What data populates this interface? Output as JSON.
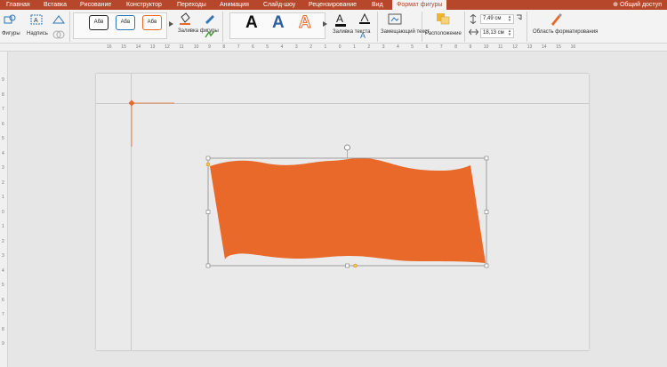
{
  "tabs": [
    "Главная",
    "Вставка",
    "Рисование",
    "Конструктор",
    "Переходы",
    "Анимация",
    "Слайд-шоу",
    "Рецензирование",
    "Вид",
    "Формат фигуры"
  ],
  "active_tab": "Формат фигуры",
  "share_label": "Общий доступ",
  "ribbon": {
    "shapes_label": "Фигуры",
    "textbox_label": "Надпись",
    "style_sample": "Абв",
    "shape_fill_label": "Заливка фигуры",
    "wordart_letter": "A",
    "text_fill_label": "Заливка текста",
    "alt_text_label": "Замещающий текст",
    "arrange_label": "Расположение",
    "height_value": "7,49 см",
    "width_value": "18,13 см",
    "format_pane_label": "Область форматирования"
  },
  "ruler_h": [
    "16",
    "15",
    "14",
    "13",
    "12",
    "11",
    "10",
    "9",
    "8",
    "7",
    "6",
    "5",
    "4",
    "3",
    "2",
    "1",
    "0",
    "1",
    "2",
    "3",
    "4",
    "5",
    "6",
    "7",
    "8",
    "9",
    "10",
    "11",
    "12",
    "13",
    "14",
    "15",
    "16"
  ],
  "ruler_v": [
    "9",
    "8",
    "7",
    "6",
    "5",
    "4",
    "3",
    "2",
    "1",
    "0",
    "1",
    "2",
    "3",
    "4",
    "5",
    "6",
    "7",
    "8",
    "9"
  ],
  "colors": {
    "accent": "#b7472a",
    "shape_fill": "#e8692a",
    "selection_handle": "#888888",
    "wordart_blue": "#2e5e9e",
    "wordart_orange": "#e8692a"
  },
  "icons": {
    "shapes": "shapes-icon",
    "textbox": "textbox-icon",
    "paint_bucket": "paint-bucket-icon",
    "pen": "pen-icon",
    "rotate": "rotate-handle-icon",
    "format_pane": "format-pane-icon"
  }
}
